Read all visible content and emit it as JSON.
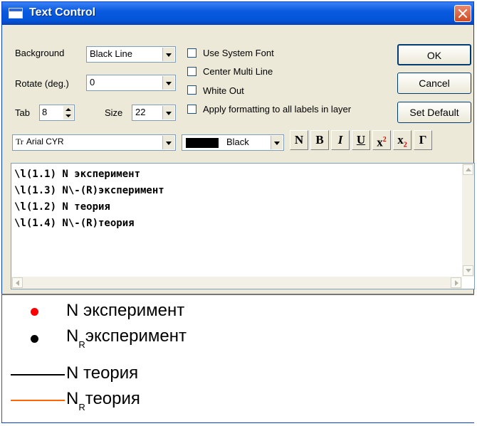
{
  "window": {
    "title": "Text Control",
    "close": "close"
  },
  "background": {
    "label": "Background",
    "value": "Black Line"
  },
  "rotate": {
    "label": "Rotate (deg.)",
    "value": "0"
  },
  "tab": {
    "label": "Tab",
    "value": "8"
  },
  "size": {
    "label": "Size",
    "value": "22"
  },
  "checkboxes": [
    {
      "label": "Use System Font",
      "checked": false
    },
    {
      "label": "Center Multi Line",
      "checked": false
    },
    {
      "label": "White Out",
      "checked": false
    },
    {
      "label": "Apply formatting to all labels in layer",
      "checked": false
    }
  ],
  "buttons": {
    "ok": "OK",
    "cancel": "Cancel",
    "set_default": "Set Default"
  },
  "font": {
    "glyph": "Tr",
    "name": "Arial CYR"
  },
  "color": {
    "name": "Black",
    "swatch": "#000000"
  },
  "format_buttons": [
    "N",
    "B",
    "I",
    "U",
    "x",
    "x",
    "Γ"
  ],
  "format_marks": {
    "sup": "2",
    "sub": "2"
  },
  "editor": {
    "lines": [
      "\\l(1.1) N эксперимент",
      "\\l(1.3) N\\-(R)эксперимент",
      "\\l(1.2) N теория",
      "\\l(1.4) N\\-(R)теория"
    ]
  },
  "preview": {
    "items": [
      {
        "text": "N эксперимент",
        "symbol": "dot",
        "color": "#ff0000"
      },
      {
        "text": "N",
        "sub": "R",
        "rest": "эксперимент",
        "symbol": "dot",
        "color": "#000000"
      },
      {
        "text": "N теория",
        "symbol": "line",
        "color": "#000000"
      },
      {
        "text": "N",
        "sub": "R",
        "rest": "теория",
        "symbol": "line",
        "color": "#ff6600"
      }
    ]
  }
}
